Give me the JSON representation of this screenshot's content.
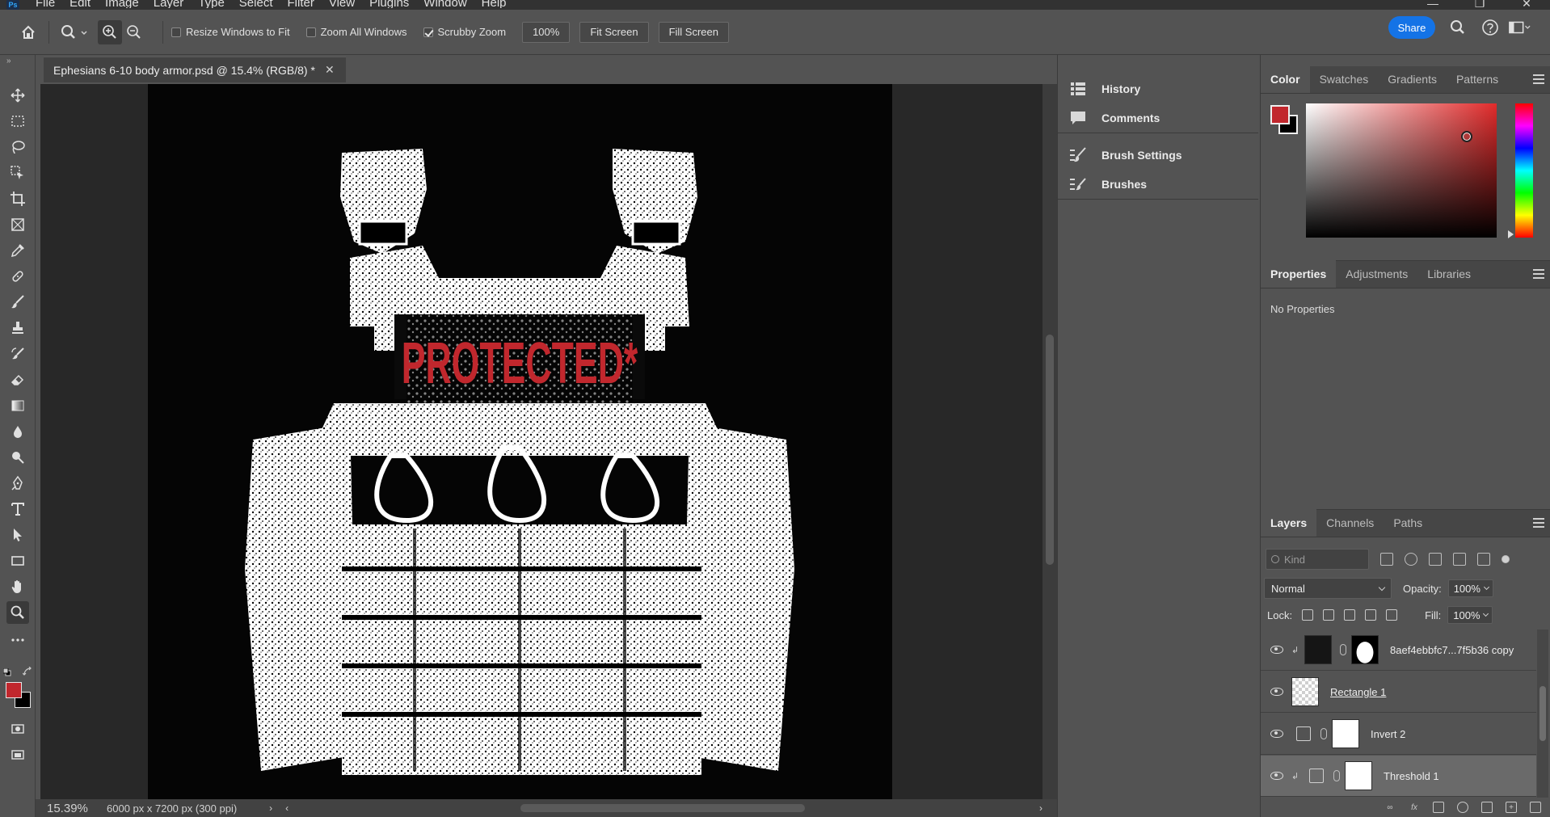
{
  "menubar": {
    "logo": "Ps",
    "items": [
      "File",
      "Edit",
      "Image",
      "Layer",
      "Type",
      "Select",
      "Filter",
      "View",
      "Plugins",
      "Window",
      "Help"
    ],
    "window_controls": [
      "—",
      "❐",
      "✕"
    ]
  },
  "options": {
    "resize_windows": "Resize Windows to Fit",
    "zoom_all": "Zoom All Windows",
    "scrubby_zoom": "Scrubby Zoom",
    "zoom_percent": "100%",
    "fit_screen": "Fit Screen",
    "fill_screen": "Fill Screen",
    "share": "Share",
    "checks": {
      "resize_windows": false,
      "zoom_all": false,
      "scrubby_zoom": true
    }
  },
  "document": {
    "tab_title": "Ephesians 6-10 body armor.psd @ 15.4% (RGB/8) *",
    "artwork_text": "PROTECTED*",
    "artwork_text_color": "#c1272d"
  },
  "status": {
    "zoom": "15.39%",
    "doc_size": "6000 px x 7200 px (300 ppi)"
  },
  "mid_panel": {
    "group1": [
      "History",
      "Comments"
    ],
    "group2": [
      "Brush Settings",
      "Brushes"
    ]
  },
  "color_panel": {
    "tabs": [
      "Color",
      "Swatches",
      "Gradients",
      "Patterns"
    ],
    "foreground": "#c1272d",
    "background": "#000000"
  },
  "properties_panel": {
    "tabs": [
      "Properties",
      "Adjustments",
      "Libraries"
    ],
    "empty_text": "No Properties"
  },
  "layers_panel": {
    "tabs": [
      "Layers",
      "Channels",
      "Paths"
    ],
    "kind_placeholder": "Kind",
    "blend_mode": "Normal",
    "opacity_label": "Opacity:",
    "opacity": "100%",
    "lock_label": "Lock:",
    "fill_label": "Fill:",
    "fill": "100%",
    "layers": [
      {
        "name": "8aef4ebbfc7...7f5b36 copy",
        "selected": false
      },
      {
        "name": "Rectangle 1",
        "selected": false
      },
      {
        "name": "Invert 2",
        "selected": false
      },
      {
        "name": "Threshold 1",
        "selected": true
      }
    ]
  },
  "accent": "#1473e6"
}
